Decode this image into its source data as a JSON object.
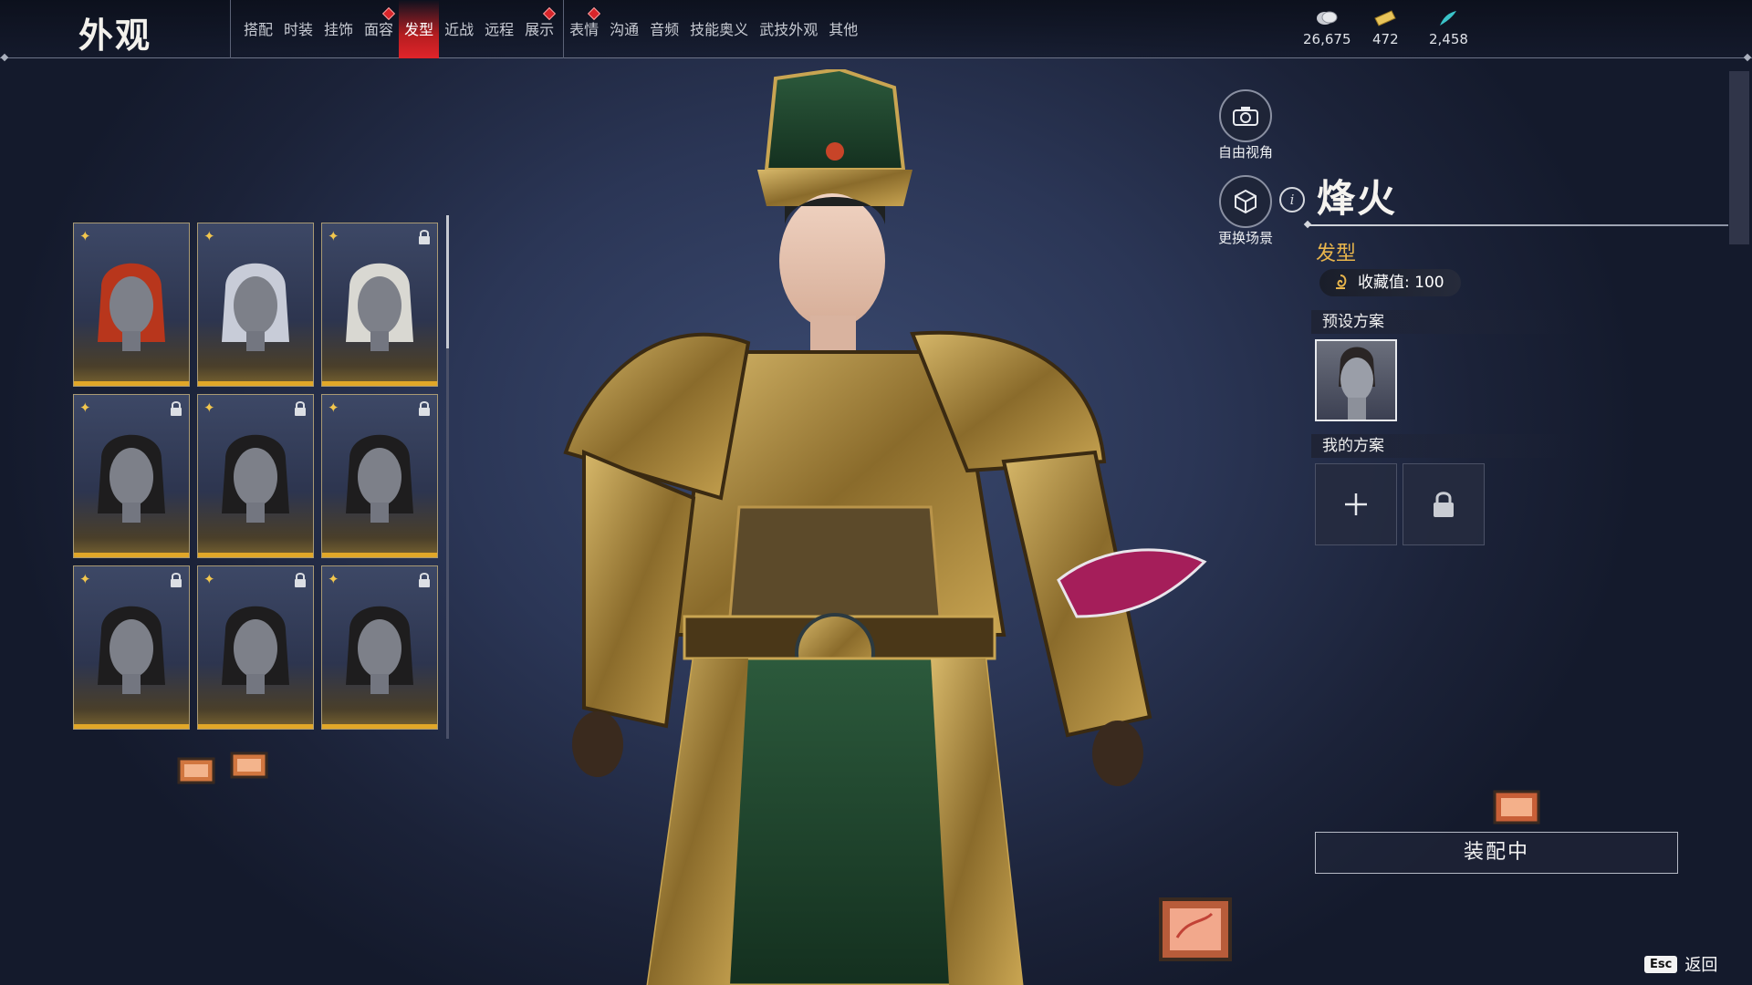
{
  "header": {
    "title": "外观",
    "tabs": [
      {
        "label": "搭配",
        "active": false,
        "dot": false
      },
      {
        "label": "时装",
        "active": false,
        "dot": false
      },
      {
        "label": "挂饰",
        "active": false,
        "dot": false
      },
      {
        "label": "面容",
        "active": false,
        "dot": true
      },
      {
        "label": "发型",
        "active": true,
        "dot": false
      },
      {
        "label": "近战",
        "active": false,
        "dot": false
      },
      {
        "label": "远程",
        "active": false,
        "dot": false
      },
      {
        "label": "展示",
        "active": false,
        "dot": true
      },
      {
        "label": "表情",
        "active": false,
        "dot": true
      },
      {
        "label": "沟通",
        "active": false,
        "dot": false
      },
      {
        "label": "音频",
        "active": false,
        "dot": false
      },
      {
        "label": "技能奥义",
        "active": false,
        "dot": false
      },
      {
        "label": "武技外观",
        "active": false,
        "dot": false
      },
      {
        "label": "其他",
        "active": false,
        "dot": false
      }
    ],
    "currencies": [
      {
        "icon": "coin-icon",
        "value": "26,675"
      },
      {
        "icon": "ticket-icon",
        "value": "472"
      },
      {
        "icon": "feather-icon",
        "value": "2,458"
      }
    ]
  },
  "hair_grid": [
    {
      "hair": "red",
      "locked": false
    },
    {
      "hair": "silver",
      "locked": false
    },
    {
      "hair": "white",
      "locked": true
    },
    {
      "hair": "dark",
      "locked": true
    },
    {
      "hair": "dark",
      "locked": true
    },
    {
      "hair": "dark",
      "locked": true
    },
    {
      "hair": "dark",
      "locked": true
    },
    {
      "hair": "dark",
      "locked": true
    },
    {
      "hair": "dark",
      "locked": true
    }
  ],
  "side_buttons": {
    "free_view": "自由视角",
    "change_scene": "更换场景"
  },
  "item": {
    "name": "烽火",
    "category": "发型",
    "collect_value": "收藏值: 100"
  },
  "sections": {
    "preset": "预设方案",
    "mine": "我的方案"
  },
  "equip_button": "装配中",
  "footer": {
    "esc_key": "Esc",
    "back_label": "返回"
  },
  "colors": {
    "accent_red": "#e0242a",
    "gold": "#e1a728",
    "category_gold": "#e8b54c"
  }
}
